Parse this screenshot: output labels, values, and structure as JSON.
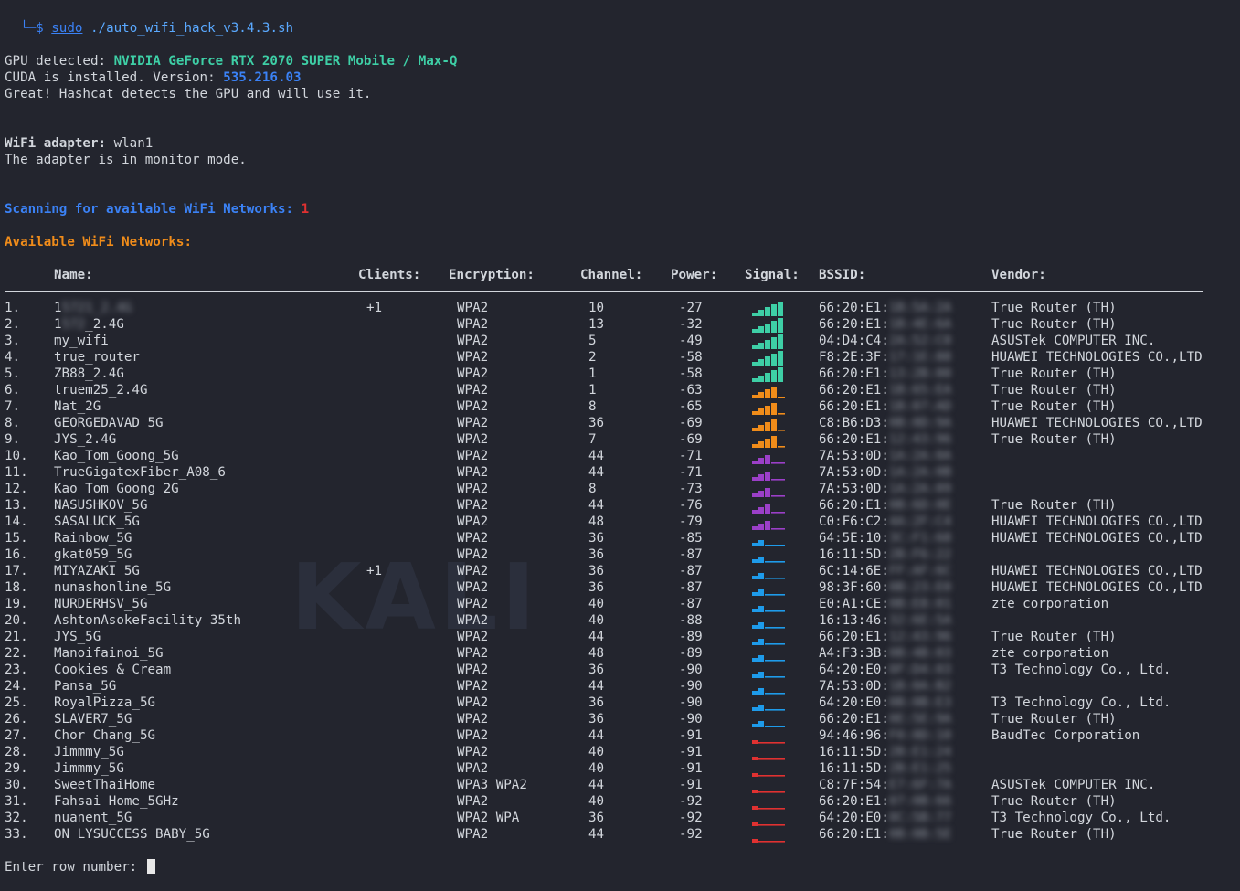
{
  "prompt": {
    "symbol": "└─$",
    "sudo": "sudo",
    "command": "./auto_wifi_hack_v3.4.3.sh"
  },
  "gpu": {
    "label": "GPU detected:",
    "name": "NVIDIA GeForce RTX 2070 SUPER Mobile / Max-Q",
    "cuda_label": "CUDA is installed. Version:",
    "cuda_version": "535.216.03",
    "hashcat_msg": "Great! Hashcat detects the GPU and will use it."
  },
  "adapter": {
    "label": "WiFi adapter:",
    "name": "wlan1",
    "mode_msg": "The adapter is in monitor mode."
  },
  "scan": {
    "label": "Scanning for available WiFi Networks:",
    "count": "1",
    "available_label": "Available WiFi Networks:"
  },
  "watermark": "KALI",
  "table": {
    "headers": {
      "name": "Name:",
      "clients": "Clients:",
      "encryption": "Encryption:",
      "channel": "Channel:",
      "power": "Power:",
      "signal": "Signal:",
      "bssid": "BSSID:",
      "vendor": "Vendor:"
    },
    "signal_colors": {
      "strong": "#3ecfa6",
      "good": "#f08c1a",
      "fair": "#9b3fc8",
      "weak": "#1e9bea",
      "poor": "#e03131"
    },
    "rows": [
      {
        "num": "1.",
        "name_a": "1",
        "name_b": "5721_2.4G",
        "clients": "+1",
        "enc": "WPA2",
        "ch": "10",
        "power": "-27",
        "signal": "strong",
        "bssid": "66:20:E1:",
        "bssid_hidden": "1B:5A:2A",
        "vendor": "True Router (TH)"
      },
      {
        "num": "2.",
        "name_a": "1",
        "name_b": "572",
        "name_c": "_2.4G",
        "clients": "",
        "enc": "WPA2",
        "ch": "13",
        "power": "-32",
        "signal": "strong",
        "bssid": "66:20:E1:",
        "bssid_hidden": "1B:4E:6A",
        "vendor": "True Router (TH)"
      },
      {
        "num": "3.",
        "name_a": "my_wifi",
        "clients": "",
        "enc": "WPA2",
        "ch": "5",
        "power": "-49",
        "signal": "strong",
        "bssid": "04:D4:C4:",
        "bssid_hidden": "2A:52:C0",
        "vendor": "ASUSTek COMPUTER INC."
      },
      {
        "num": "4.",
        "name_a": "true_router",
        "clients": "",
        "enc": "WPA2",
        "ch": "2",
        "power": "-58",
        "signal": "strong",
        "bssid": "F8:2E:3F:",
        "bssid_hidden": "17:1E:88",
        "vendor": "HUAWEI TECHNOLOGIES CO.,LTD"
      },
      {
        "num": "5.",
        "name_a": "ZB88_2.4G",
        "clients": "",
        "enc": "WPA2",
        "ch": "1",
        "power": "-58",
        "signal": "strong",
        "bssid": "66:20:E1:",
        "bssid_hidden": "13:2B:00",
        "vendor": "True Router (TH)"
      },
      {
        "num": "6.",
        "name_a": "truem25_2.4G",
        "clients": "",
        "enc": "WPA2",
        "ch": "1",
        "power": "-63",
        "signal": "good",
        "bssid": "66:20:E1:",
        "bssid_hidden": "1B:65:EA",
        "vendor": "True Router (TH)"
      },
      {
        "num": "7.",
        "name_a": "Nat_2G",
        "clients": "",
        "enc": "WPA2",
        "ch": "8",
        "power": "-65",
        "signal": "good",
        "bssid": "66:20:E1:",
        "bssid_hidden": "1B:07:AD",
        "vendor": "True Router (TH)"
      },
      {
        "num": "8.",
        "name_a": "GEORGEDAVAD_5G",
        "clients": "",
        "enc": "WPA2",
        "ch": "36",
        "power": "-69",
        "signal": "good",
        "bssid": "C8:B6:D3:",
        "bssid_hidden": "0B:0D:9A",
        "vendor": "HUAWEI TECHNOLOGIES CO.,LTD"
      },
      {
        "num": "9.",
        "name_a": "JYS_2.4G",
        "clients": "",
        "enc": "WPA2",
        "ch": "7",
        "power": "-69",
        "signal": "good",
        "bssid": "66:20:E1:",
        "bssid_hidden": "12:43:96",
        "vendor": "True Router (TH)"
      },
      {
        "num": "10.",
        "name_a": "Kao_Tom_Goong_5G",
        "clients": "",
        "enc": "WPA2",
        "ch": "44",
        "power": "-71",
        "signal": "fair",
        "bssid": "7A:53:0D:",
        "bssid_hidden": "1A:2A:0A",
        "vendor": ""
      },
      {
        "num": "11.",
        "name_a": "TrueGigatexFiber_A08_6",
        "clients": "",
        "enc": "WPA2",
        "ch": "44",
        "power": "-71",
        "signal": "fair",
        "bssid": "7A:53:0D:",
        "bssid_hidden": "1A:2A:0B",
        "vendor": ""
      },
      {
        "num": "12.",
        "name_a": "Kao Tom Goong 2G",
        "clients": "",
        "enc": "WPA2",
        "ch": "8",
        "power": "-73",
        "signal": "fair",
        "bssid": "7A:53:0D:",
        "bssid_hidden": "1A:2A:09",
        "vendor": ""
      },
      {
        "num": "13.",
        "name_a": "NASUSHKOV_5G",
        "clients": "",
        "enc": "WPA2",
        "ch": "44",
        "power": "-76",
        "signal": "fair",
        "bssid": "66:20:E1:",
        "bssid_hidden": "0B:6D:0E",
        "vendor": "True Router (TH)"
      },
      {
        "num": "14.",
        "name_a": "SASALUCK_5G",
        "clients": "",
        "enc": "WPA2",
        "ch": "48",
        "power": "-79",
        "signal": "fair",
        "bssid": "C0:F6:C2:",
        "bssid_hidden": "4A:2F:C4",
        "vendor": "HUAWEI TECHNOLOGIES CO.,LTD"
      },
      {
        "num": "15.",
        "name_a": "Rainbow_5G",
        "clients": "",
        "enc": "WPA2",
        "ch": "36",
        "power": "-85",
        "signal": "weak",
        "bssid": "64:5E:10:",
        "bssid_hidden": "3C:F1:68",
        "vendor": "HUAWEI TECHNOLOGIES CO.,LTD"
      },
      {
        "num": "16.",
        "name_a": "gkat059_5G",
        "clients": "",
        "enc": "WPA2",
        "ch": "36",
        "power": "-87",
        "signal": "weak",
        "bssid": "16:11:5D:",
        "bssid_hidden": "2B:F6:22",
        "vendor": ""
      },
      {
        "num": "17.",
        "name_a": "MIYAZAKI_5G",
        "clients": "+1",
        "enc": "WPA2",
        "ch": "36",
        "power": "-87",
        "signal": "weak",
        "bssid": "6C:14:6E:",
        "bssid_hidden": "FF:AF:6C",
        "vendor": "HUAWEI TECHNOLOGIES CO.,LTD"
      },
      {
        "num": "18.",
        "name_a": "nunashonline_5G",
        "clients": "",
        "enc": "WPA2",
        "ch": "36",
        "power": "-87",
        "signal": "weak",
        "bssid": "98:3F:60:",
        "bssid_hidden": "0B:23:E0",
        "vendor": "HUAWEI TECHNOLOGIES CO.,LTD"
      },
      {
        "num": "19.",
        "name_a": "NURDERHSV_5G",
        "clients": "",
        "enc": "WPA2",
        "ch": "40",
        "power": "-87",
        "signal": "weak",
        "bssid": "E0:A1:CE:",
        "bssid_hidden": "0B:E8:01",
        "vendor": "zte corporation"
      },
      {
        "num": "20.",
        "name_a": "AshtonAsokeFacility 35th",
        "clients": "",
        "enc": "WPA2",
        "ch": "40",
        "power": "-88",
        "signal": "weak",
        "bssid": "16:13:46:",
        "bssid_hidden": "32:6E:5A",
        "vendor": ""
      },
      {
        "num": "21.",
        "name_a": "JYS_5G",
        "clients": "",
        "enc": "WPA2",
        "ch": "44",
        "power": "-89",
        "signal": "weak",
        "bssid": "66:20:E1:",
        "bssid_hidden": "12:43:96",
        "vendor": "True Router (TH)"
      },
      {
        "num": "22.",
        "name_a": "Manoifainoi_5G",
        "clients": "",
        "enc": "WPA2",
        "ch": "48",
        "power": "-89",
        "signal": "weak",
        "bssid": "A4:F3:3B:",
        "bssid_hidden": "0B:4B:03",
        "vendor": "zte corporation"
      },
      {
        "num": "23.",
        "name_a": "Cookies & Cream",
        "clients": "",
        "enc": "WPA2",
        "ch": "36",
        "power": "-90",
        "signal": "weak",
        "bssid": "64:20:E0:",
        "bssid_hidden": "0F:D4:03",
        "vendor": "T3 Technology Co., Ltd."
      },
      {
        "num": "24.",
        "name_a": "Pansa_5G",
        "clients": "",
        "enc": "WPA2",
        "ch": "44",
        "power": "-90",
        "signal": "weak",
        "bssid": "7A:53:0D:",
        "bssid_hidden": "1B:0A:B2",
        "vendor": ""
      },
      {
        "num": "25.",
        "name_a": "RoyalPizza_5G",
        "clients": "",
        "enc": "WPA2",
        "ch": "36",
        "power": "-90",
        "signal": "weak",
        "bssid": "64:20:E0:",
        "bssid_hidden": "0B:0B:E3",
        "vendor": "T3 Technology Co., Ltd."
      },
      {
        "num": "26.",
        "name_a": "SLAVER7_5G",
        "clients": "",
        "enc": "WPA2",
        "ch": "36",
        "power": "-90",
        "signal": "weak",
        "bssid": "66:20:E1:",
        "bssid_hidden": "0E:5E:9A",
        "vendor": "True Router (TH)"
      },
      {
        "num": "27.",
        "name_a": "Chor Chang_5G",
        "clients": "",
        "enc": "WPA2",
        "ch": "44",
        "power": "-91",
        "signal": "poor",
        "bssid": "94:46:96:",
        "bssid_hidden": "F0:0D:10",
        "vendor": "BaudTec Corporation"
      },
      {
        "num": "28.",
        "name_a": "Jimmmy_5G",
        "clients": "",
        "enc": "WPA2",
        "ch": "40",
        "power": "-91",
        "signal": "poor",
        "bssid": "16:11:5D:",
        "bssid_hidden": "2B:E1:24",
        "vendor": ""
      },
      {
        "num": "29.",
        "name_a": "Jimmmy_5G",
        "clients": "",
        "enc": "WPA2",
        "ch": "40",
        "power": "-91",
        "signal": "poor",
        "bssid": "16:11:5D:",
        "bssid_hidden": "2B:E1:25",
        "vendor": ""
      },
      {
        "num": "30.",
        "name_a": "SweetThaiHome",
        "clients": "",
        "enc": "WPA3 WPA2",
        "ch": "44",
        "power": "-91",
        "signal": "poor",
        "bssid": "C8:7F:54:",
        "bssid_hidden": "E7:6F:7A",
        "vendor": "ASUSTek COMPUTER INC."
      },
      {
        "num": "31.",
        "name_a": "Fahsai Home_5GHz",
        "clients": "",
        "enc": "WPA2",
        "ch": "40",
        "power": "-92",
        "signal": "poor",
        "bssid": "66:20:E1:",
        "bssid_hidden": "07:0B:66",
        "vendor": "True Router (TH)"
      },
      {
        "num": "32.",
        "name_a": "nuanent_5G",
        "clients": "",
        "enc": "WPA2 WPA",
        "ch": "36",
        "power": "-92",
        "signal": "poor",
        "bssid": "64:20:E0:",
        "bssid_hidden": "0C:5B:77",
        "vendor": "T3 Technology Co., Ltd."
      },
      {
        "num": "33.",
        "name_a": "ON LYSUCCESS BABY_5G",
        "clients": "",
        "enc": "WPA2",
        "ch": "44",
        "power": "-92",
        "signal": "poor",
        "bssid": "66:20:E1:",
        "bssid_hidden": "0B:0B:5E",
        "vendor": "True Router (TH)"
      }
    ]
  },
  "input": {
    "label": "Enter row number:"
  }
}
